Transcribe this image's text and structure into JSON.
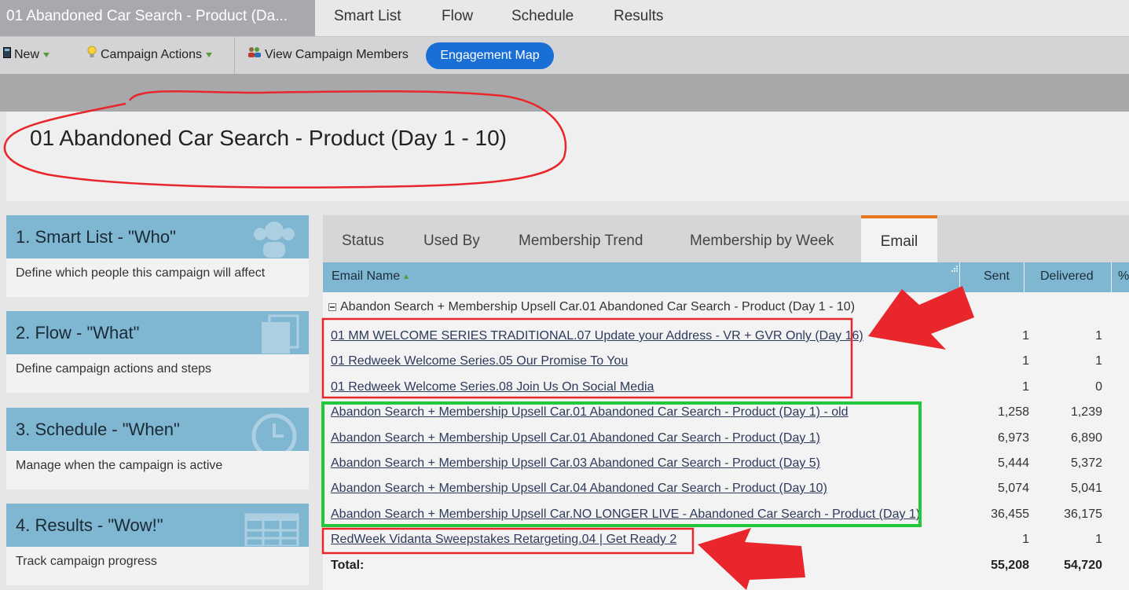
{
  "top_tabs": {
    "title": "01 Abandoned Car Search - Product (Da...",
    "items": [
      "Smart List",
      "Flow",
      "Schedule",
      "Results"
    ]
  },
  "toolbar": {
    "new_label": "New",
    "campaign_actions_label": "Campaign Actions",
    "view_members_label": "View Campaign Members",
    "engagement_map_label": "Engagement Map"
  },
  "page_title": "01 Abandoned Car Search - Product (Day 1 - 10)",
  "cards": [
    {
      "title": "1. Smart List - \"Who\"",
      "desc": "Define which people this campaign will affect"
    },
    {
      "title": "2. Flow - \"What\"",
      "desc": "Define campaign actions and steps"
    },
    {
      "title": "3. Schedule - \"When\"",
      "desc": "Manage when the campaign is active"
    },
    {
      "title": "4. Results - \"Wow!\"",
      "desc": "Track campaign progress"
    }
  ],
  "panel_tabs": [
    "Status",
    "Used By",
    "Membership Trend",
    "Membership by Week",
    "Email"
  ],
  "table": {
    "headers": {
      "email_name": "Email Name",
      "sent": "Sent",
      "delivered": "Delivered",
      "pct": "%"
    },
    "group": "Abandon Search + Membership Upsell Car.01 Abandoned Car Search - Product (Day 1 - 10)",
    "rows": [
      {
        "name": "01 MM WELCOME SERIES TRADITIONAL.07 Update your Address - VR + GVR Only (Day 16)",
        "sent": "1",
        "delivered": "1"
      },
      {
        "name": "01 Redweek Welcome Series.05 Our Promise To You",
        "sent": "1",
        "delivered": "1"
      },
      {
        "name": "01 Redweek Welcome Series.08 Join Us On Social Media",
        "sent": "1",
        "delivered": "0"
      },
      {
        "name": "Abandon Search + Membership Upsell Car.01 Abandoned Car Search - Product (Day 1) - old",
        "sent": "1,258",
        "delivered": "1,239"
      },
      {
        "name": "Abandon Search + Membership Upsell Car.01 Abandoned Car Search - Product (Day 1)",
        "sent": "6,973",
        "delivered": "6,890"
      },
      {
        "name": "Abandon Search + Membership Upsell Car.03 Abandoned Car Search - Product (Day 5)",
        "sent": "5,444",
        "delivered": "5,372"
      },
      {
        "name": "Abandon Search + Membership Upsell Car.04 Abandoned Car Search - Product (Day 10)",
        "sent": "5,074",
        "delivered": "5,041"
      },
      {
        "name": "Abandon Search + Membership Upsell Car.NO LONGER LIVE - Abandoned Car Search - Product (Day 1)",
        "sent": "36,455",
        "delivered": "36,175"
      },
      {
        "name": "RedWeek Vidanta Sweepstakes Retargeting.04 | Get Ready 2",
        "sent": "1",
        "delivered": "1"
      }
    ],
    "total": {
      "label": "Total:",
      "sent": "55,208",
      "delivered": "54,720"
    }
  },
  "colors": {
    "annotation_red": "#e8262c",
    "annotation_green": "#22c73a",
    "accent_blue": "#1a6fd6",
    "header_blue": "#7fb6d2",
    "active_tab_orange": "#e87722"
  }
}
